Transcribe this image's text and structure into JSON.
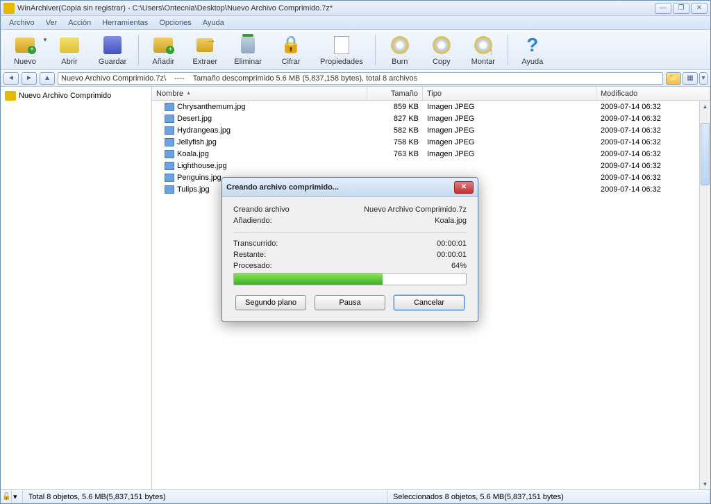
{
  "titlebar": {
    "text": "WinArchiver(Copia sin registrar) - C:\\Users\\Ontecnia\\Desktop\\Nuevo Archivo Comprimido.7z*"
  },
  "menubar": {
    "items": [
      "Archivo",
      "Ver",
      "Acción",
      "Herramientas",
      "Opciones",
      "Ayuda"
    ]
  },
  "toolbar": {
    "nuevo": "Nuevo",
    "abrir": "Abrir",
    "guardar": "Guardar",
    "anadir": "Añadir",
    "extraer": "Extraer",
    "eliminar": "Eliminar",
    "cifrar": "Cifrar",
    "propiedades": "Propiedades",
    "burn": "Burn",
    "copy": "Copy",
    "montar": "Montar",
    "ayuda": "Ayuda"
  },
  "navbar": {
    "path": "Nuevo Archivo Comprimido.7z\\",
    "sep": "----",
    "info": "Tamaño descomprimido 5.6 MB (5,837,158 bytes), total 8 archivos"
  },
  "tree": {
    "root": "Nuevo Archivo Comprimido"
  },
  "columns": {
    "name": "Nombre",
    "size": "Tamaño",
    "type": "Tipo",
    "modified": "Modificado"
  },
  "files": [
    {
      "name": "Chrysanthemum.jpg",
      "size": "859 KB",
      "type": "Imagen JPEG",
      "modified": "2009-07-14 06:32"
    },
    {
      "name": "Desert.jpg",
      "size": "827 KB",
      "type": "Imagen JPEG",
      "modified": "2009-07-14 06:32"
    },
    {
      "name": "Hydrangeas.jpg",
      "size": "582 KB",
      "type": "Imagen JPEG",
      "modified": "2009-07-14 06:32"
    },
    {
      "name": "Jellyfish.jpg",
      "size": "758 KB",
      "type": "Imagen JPEG",
      "modified": "2009-07-14 06:32"
    },
    {
      "name": "Koala.jpg",
      "size": "763 KB",
      "type": "Imagen JPEG",
      "modified": "2009-07-14 06:32"
    },
    {
      "name": "Lighthouse.jpg",
      "size": "",
      "type": "",
      "modified": "2009-07-14 06:32"
    },
    {
      "name": "Penguins.jpg",
      "size": "",
      "type": "",
      "modified": "2009-07-14 06:32"
    },
    {
      "name": "Tulips.jpg",
      "size": "",
      "type": "",
      "modified": "2009-07-14 06:32"
    }
  ],
  "dialog": {
    "title": "Creando archivo comprimido...",
    "creating_label": "Creando archivo",
    "creating_value": "Nuevo Archivo Comprimido.7z",
    "adding_label": "Añadiendo:",
    "adding_value": "Koala.jpg",
    "elapsed_label": "Transcurrido:",
    "elapsed_value": "00:00:01",
    "remaining_label": "Restante:",
    "remaining_value": "00:00:01",
    "processed_label": "Procesado:",
    "processed_value": "64%",
    "progress_pct": 64,
    "btn_background": "Segundo plano",
    "btn_pause": "Pausa",
    "btn_cancel": "Cancelar"
  },
  "statusbar": {
    "left": "Total 8 objetos, 5.6 MB(5,837,151 bytes)",
    "right": "Seleccionados 8 objetos, 5.6 MB(5,837,151 bytes)"
  }
}
